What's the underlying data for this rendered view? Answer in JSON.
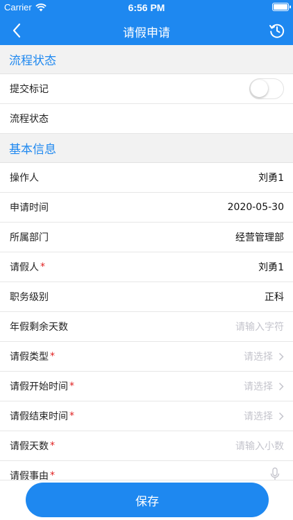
{
  "status_bar": {
    "carrier": "Carrier",
    "time": "6:56 PM"
  },
  "nav": {
    "title": "请假申请",
    "back_icon": "chevron-left-icon",
    "history_icon": "history-clock-icon"
  },
  "colors": {
    "primary": "#1e88f0",
    "required": "#e02020",
    "placeholder": "#c4c4cc"
  },
  "sections": {
    "process": {
      "title": "流程状态",
      "submit_flag_label": "提交标记",
      "submit_flag_on": false,
      "process_status_label": "流程状态"
    },
    "basic": {
      "title": "基本信息",
      "operator_label": "操作人",
      "operator_value": "刘勇1",
      "apply_time_label": "申请时间",
      "apply_time_value": "2020-05-30",
      "department_label": "所属部门",
      "department_value": "经营管理部",
      "applicant_label": "请假人",
      "applicant_value": "刘勇1",
      "rank_label": "职务级别",
      "rank_value": "正科",
      "annual_leave_label": "年假剩余天数",
      "annual_leave_placeholder": "请输入字符",
      "leave_type_label": "请假类型",
      "leave_type_placeholder": "请选择",
      "start_time_label": "请假开始时间",
      "start_time_placeholder": "请选择",
      "end_time_label": "请假结束时间",
      "end_time_placeholder": "请选择",
      "leave_days_label": "请假天数",
      "leave_days_placeholder": "请输入小数",
      "reason_label": "请假事由",
      "required_mark": "*"
    }
  },
  "footer": {
    "save_label": "保存"
  }
}
